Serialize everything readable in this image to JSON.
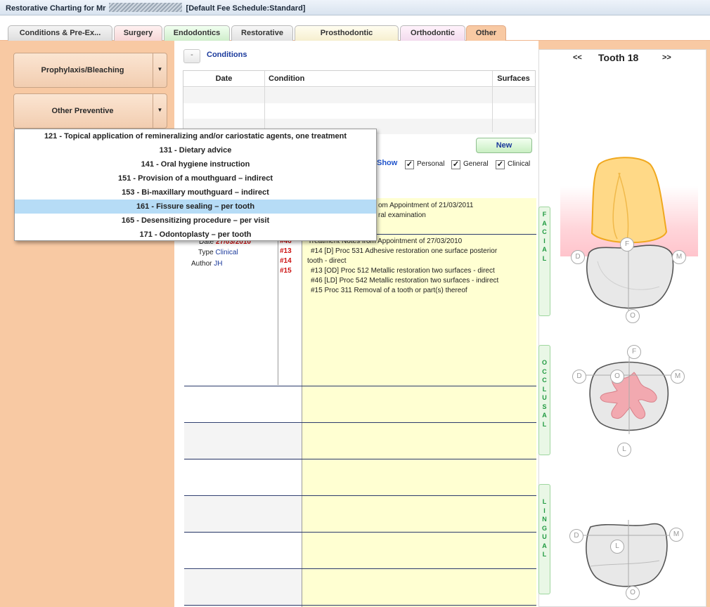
{
  "window": {
    "title_prefix": "Restorative Charting for Mr",
    "title_suffix": "[Default Fee Schedule:Standard]"
  },
  "tabs": [
    {
      "label": "Conditions & Pre-Ex..."
    },
    {
      "label": "Surgery"
    },
    {
      "label": "Endodontics"
    },
    {
      "label": "Restorative"
    },
    {
      "label": "Prosthodontic"
    },
    {
      "label": "Orthodontic"
    },
    {
      "label": "Other"
    }
  ],
  "left": {
    "prophylaxis_label": "Prophylaxis/Bleaching",
    "preventive_label": "Other Preventive",
    "arrow_glyph": "▼"
  },
  "menu": {
    "items": [
      {
        "label": "121 - Topical application of remineralizing and/or cariostatic agents, one treatment"
      },
      {
        "label": "131 - Dietary advice"
      },
      {
        "label": "141 - Oral hygiene instruction"
      },
      {
        "label": "151 - Provision of a mouthguard – indirect"
      },
      {
        "label": "153 - Bi-maxillary mouthguard – indirect"
      },
      {
        "label": "161 - Fissure sealing – per tooth"
      },
      {
        "label": "165 - Desensitizing procedure – per visit"
      },
      {
        "label": "171 - Odontoplasty – per tooth"
      }
    ]
  },
  "conditions": {
    "collapse_glyph": "-",
    "title": "Conditions",
    "columns": {
      "date": "Date",
      "condition": "Condition",
      "surfaces": "Surfaces"
    },
    "new_label": "New",
    "show_label": "Show",
    "filters": [
      {
        "label": "Personal",
        "mark": "✓"
      },
      {
        "label": "General",
        "mark": "✓"
      },
      {
        "label": "Clinical",
        "mark": "✓"
      }
    ]
  },
  "notes": {
    "note1_line1": "om Appointment of 21/03/2011",
    "note1_line2": "ral examination",
    "note2": {
      "date_label": "Date",
      "date_value": "27/03/2010",
      "type_label": "Type",
      "type_value": "Clinical",
      "author_label": "Author",
      "author_value": "JH",
      "teeth": [
        "#46",
        "#13",
        "#14",
        "#15"
      ],
      "lines": [
        "Treatment Notes from Appointment of 27/03/2010",
        "#14 [D] Proc 531 Adhesive restoration  one surface  posterior",
        "tooth - direct",
        "#13 [OD] Proc 512 Metallic restoration  two surfaces - direct",
        "#46 [LD] Proc 542 Metallic restoration  two surfaces - indirect",
        "#15 Proc 311 Removal of a tooth or part(s) thereof"
      ]
    }
  },
  "side_labels": {
    "facial": [
      "F",
      "A",
      "C",
      "I",
      "A",
      "L"
    ],
    "occlusal": [
      "O",
      "C",
      "C",
      "L",
      "U",
      "S",
      "A",
      "L"
    ],
    "lingual": [
      "L",
      "I",
      "N",
      "G",
      "U",
      "A",
      "L"
    ]
  },
  "tooth": {
    "title": "Tooth 18",
    "prev": "<<",
    "next": ">>",
    "facial_view": {
      "F": "F",
      "D": "D",
      "M": "M",
      "O": "O"
    },
    "occlusal_view": {
      "F": "F",
      "D": "D",
      "M": "M",
      "O": "O",
      "L": "L"
    },
    "lingual_view": {
      "D": "D",
      "M": "M",
      "L": "L",
      "O": "O"
    }
  }
}
